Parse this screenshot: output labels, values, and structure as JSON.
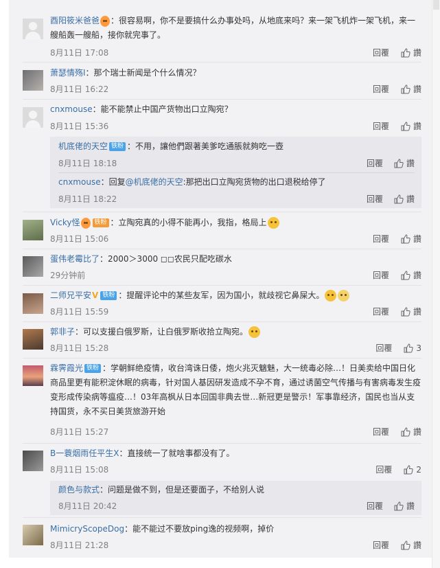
{
  "reply_label": "回覆",
  "like_label": "讚",
  "comments": [
    {
      "nick": "酉阳筱米爸爸",
      "text": "：很容易啊，你不是要搞什么办事处吗，从地底来吗？来一架飞机炸一架飞机，来一艘船轰一艘船，接你就完事了。",
      "time": "8月11日 17:08",
      "likes": ""
    },
    {
      "nick": "萧瑟情殇I",
      "text": "：那个瑞士新闻是个什么情况？",
      "time": "8月11日 16:22",
      "likes": ""
    },
    {
      "nick": "cnxmouse",
      "text": "：能不能禁止中国产货物出口立陶宛？",
      "time": "8月11日 15:36",
      "likes": "",
      "replies": [
        {
          "nick": "机底佬的天空",
          "badge": "铁粉",
          "text": "：不用，讓他們跟著美爹吃通脹就夠吃一壺",
          "time": "8月11日 18:18",
          "likes": ""
        },
        {
          "nick": "cnxmouse",
          "text": "：回复",
          "mention": "@机底佬的天空",
          "text2": ":那把出口立陶宛货物的出口退税给停了",
          "time": "8月11日 18:22",
          "likes": ""
        }
      ]
    },
    {
      "nick": "Vicky怪",
      "badge": "铁粉",
      "text": "：立陶宛真的小得不能再小，我指，格局上",
      "time": "8月11日 15:06",
      "likes": ""
    },
    {
      "nick": "蛋伟老霉比了",
      "text": "：2000＞3000  ◻◻农民只配吃碳水",
      "time": "29分钟前",
      "likes": ""
    },
    {
      "nick": "二师兄平安",
      "vbadge": "V",
      "badge": "铁粉",
      "text": "：提醒评论中的某些友军，因为国小，就歧视它鼻屎大。",
      "time": "8月11日 15:59",
      "likes": ""
    },
    {
      "nick": "郭非子",
      "text": "：可以支援白俄罗斯，让白俄罗斯收拾立陶宛。",
      "time": "8月11日 15:28",
      "likes": "3"
    },
    {
      "nick": "霖霁霞光",
      "badge": "铁粉",
      "text": "：学朝鲜绝疫情，收台湾诛日倭，炮火兆灭魑魅，大一统毒必除…！日美卖给中国日化商品里更有能积淀休眠的病毒，针对国人基因研发造成不孕不育，通过诱菌空气传播与有害病毒发生疫变形成传染病等瘟疫…！03年高枫从日本回国非典去世…新冠更是警示！军事靠经济，国民也当从支持国货，永不买日美货旅游开始",
      "time": "8月11日 15:27",
      "likes": ""
    },
    {
      "nick": "B一蓑烟雨任平生X",
      "text": "：直接统一了就啥事都没有了。",
      "time": "8月11日 15:08",
      "likes": "2",
      "replies": [
        {
          "nick": "颜色与款式",
          "text": "：问题是做不到，但是还要面子，不给别人说",
          "time": "8月11日 20:42",
          "likes": ""
        }
      ]
    },
    {
      "nick": "MimicryScopeDog",
      "text": "：能不能过不要放ping逸的视频啊，掉价",
      "time": "8月11日 21:28",
      "likes": ""
    }
  ]
}
